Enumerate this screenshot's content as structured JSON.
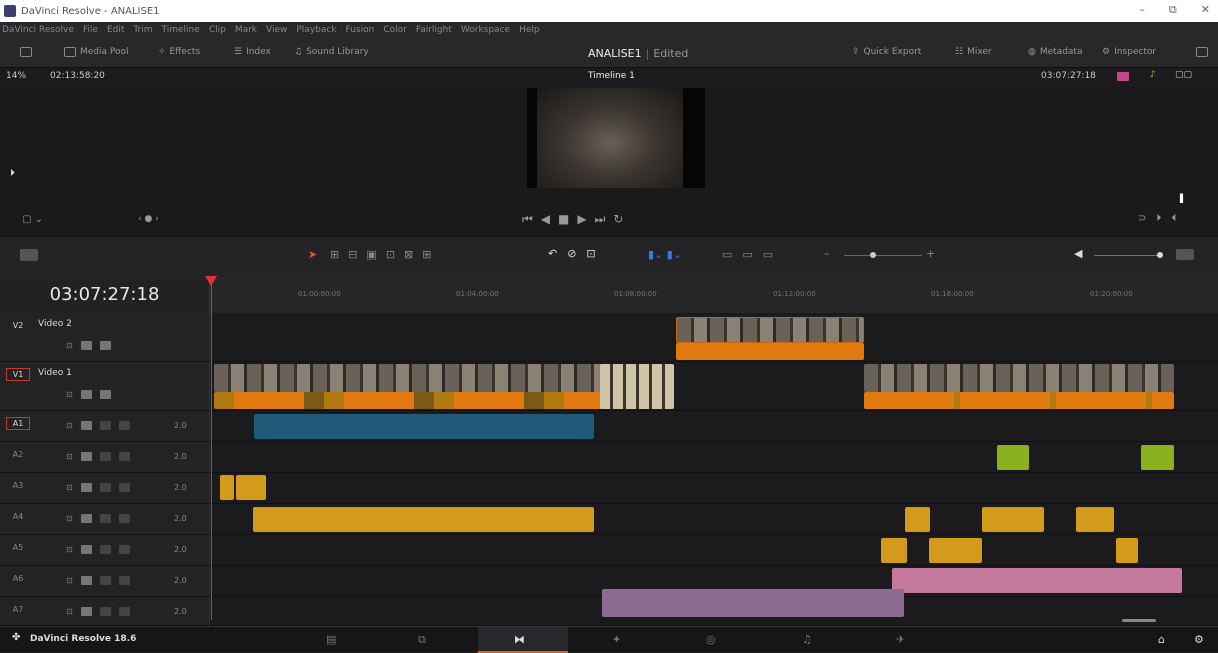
{
  "window": {
    "title": "DaVinci Resolve - ANALISE1"
  },
  "menu": [
    "DaVinci Resolve",
    "File",
    "Edit",
    "Trim",
    "Timeline",
    "Clip",
    "Mark",
    "View",
    "Playback",
    "Fusion",
    "Color",
    "Fairlight",
    "Workspace",
    "Help"
  ],
  "toolbar": {
    "media_pool": "Media Pool",
    "effects": "Effects",
    "index": "Index",
    "sound_library": "Sound Library",
    "project": "ANALISE1",
    "status": "Edited",
    "quick_export": "Quick Export",
    "mixer": "Mixer",
    "metadata": "Metadata",
    "inspector": "Inspector"
  },
  "viewer": {
    "zoom": "14%",
    "source_tc": "02:13:58:20",
    "timeline_name": "Timeline 1",
    "record_tc": "03:07:27:18"
  },
  "timeline": {
    "timecode": "03:07:27:18",
    "ruler": [
      "01:00:00:00",
      "01:04:00:00",
      "01:08:00:00",
      "01:12:00:00",
      "01:16:00:00",
      "01:20:00:00"
    ],
    "tracks": [
      {
        "id": "V2",
        "name": "Video 2"
      },
      {
        "id": "V1",
        "name": "Video 1"
      },
      {
        "id": "A1",
        "ch": "2.0"
      },
      {
        "id": "A2",
        "ch": "2.0"
      },
      {
        "id": "A3",
        "ch": "2.0"
      },
      {
        "id": "A4",
        "ch": "2.0"
      },
      {
        "id": "A5",
        "ch": "2.0"
      },
      {
        "id": "A6",
        "ch": "2.0"
      },
      {
        "id": "A7",
        "ch": "2.0"
      }
    ]
  },
  "app": {
    "version": "DaVinci Resolve 18.6"
  },
  "colors": {
    "audio_blue": "#1f5a78",
    "audio_yellow": "#d49a1c",
    "audio_green": "#8ab21e",
    "audio_pink": "#c4789e",
    "audio_purple": "#8c6a92",
    "video_orange": "#e07a10",
    "playhead": "#dd3333"
  }
}
